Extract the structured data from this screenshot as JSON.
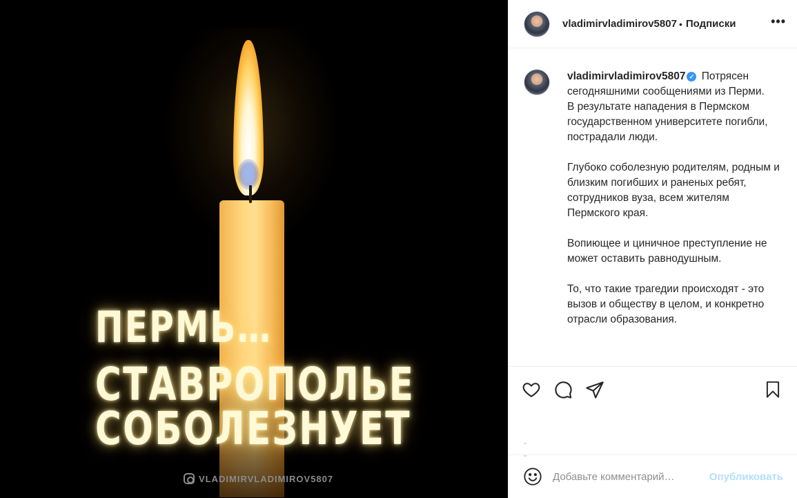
{
  "image": {
    "headline_line1": "ПЕРМЬ…",
    "headline_line2": "СТАВРОПОЛЬЕ",
    "headline_line3": "СОБОЛЕЗНУЕТ",
    "watermark": "VLADIMIRVLADIMIROV5807"
  },
  "header": {
    "username": "vladimirvladimirov5807",
    "separator": "•",
    "follow_label": "Подписки",
    "more_label": "•••"
  },
  "caption": {
    "username": "vladimirvladimirov5807",
    "verified_mark": "✓",
    "paragraphs": [
      "Потрясен сегодняшними сообщениями из Перми.",
      "В результате нападения в Пермском государственном университете погибли, пострадали люди.",
      "Глубоко соболезную родителям, родным и близким погибших и раненых ребят, сотрудников вуза, всем жителям Пермского края.",
      "Вопиющее и циничное преступление не может оставить равнодушным.",
      "То, что такие трагедии происходят - это вызов и обществу в целом, и конкретно отрасли образования."
    ]
  },
  "actions": {
    "icons": [
      "heart-icon",
      "comment-icon",
      "share-icon",
      "bookmark-icon"
    ]
  },
  "comment": {
    "placeholder": "Добавьте комментарий…",
    "publish_label": "Опубликовать",
    "publish_color": "#b2dffc"
  },
  "colors": {
    "verified": "#3897f0",
    "text": "#262626",
    "border": "#efefef"
  }
}
